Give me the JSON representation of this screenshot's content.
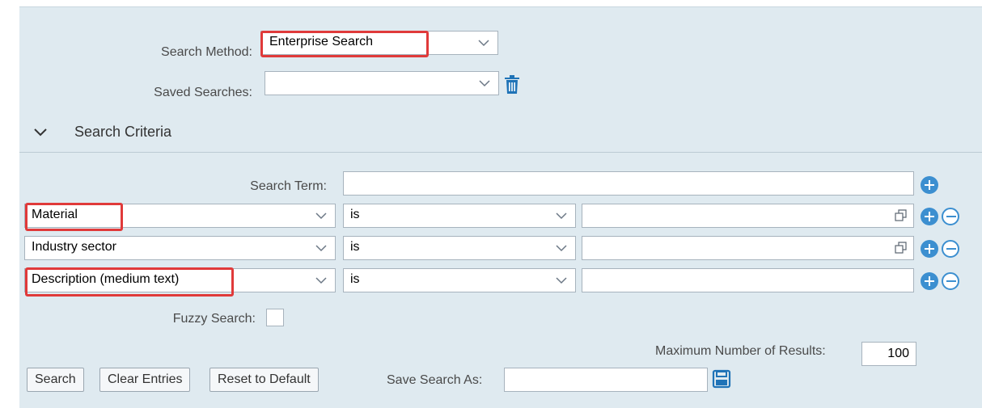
{
  "header": {
    "search_method_label": "Search Method:",
    "search_method_value": "Enterprise Search",
    "saved_searches_label": "Saved Searches:",
    "saved_searches_value": ""
  },
  "section": {
    "title": "Search Criteria"
  },
  "criteria": {
    "search_term_label": "Search Term:",
    "search_term_value": "",
    "rows": [
      {
        "field": "Material",
        "operator": "is",
        "value": ""
      },
      {
        "field": "Industry sector",
        "operator": "is",
        "value": ""
      },
      {
        "field": "Description (medium text)",
        "operator": "is",
        "value": ""
      }
    ],
    "fuzzy_label": "Fuzzy Search:",
    "fuzzy_checked": false
  },
  "footer": {
    "max_results_label": "Maximum Number of Results:",
    "max_results_value": "100",
    "search_button": "Search",
    "clear_button": "Clear Entries",
    "reset_button": "Reset to Default",
    "save_search_label": "Save Search As:",
    "save_search_value": ""
  },
  "colors": {
    "accent": "#3c8fd0",
    "highlight": "#e03a3a",
    "panel_bg": "#dfeaf0"
  },
  "icons": [
    "chevron-down-icon",
    "trash-icon",
    "add-icon",
    "remove-icon",
    "value-help-icon",
    "save-icon"
  ]
}
